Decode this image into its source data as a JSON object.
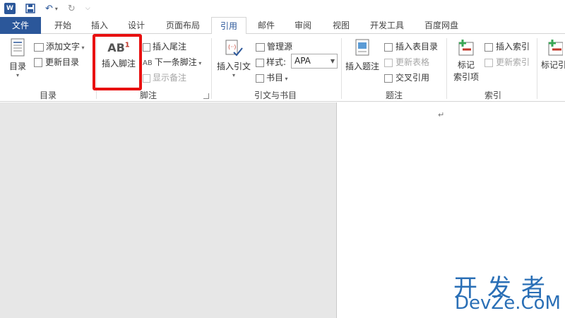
{
  "qat": {
    "app_logo": "W",
    "undo_label": "↶",
    "redo_label": "↻",
    "customize": "⌵"
  },
  "tabs": {
    "file": "文件",
    "items": [
      "开始",
      "插入",
      "设计",
      "页面布局",
      "引用",
      "邮件",
      "审阅",
      "视图",
      "开发工具",
      "百度网盘"
    ],
    "active": "引用"
  },
  "ribbon": {
    "toc": {
      "big": "目录",
      "add_text": "添加文字",
      "update": "更新目录",
      "group": "目录"
    },
    "footnotes": {
      "insert_footnote": "插入脚注",
      "insert_endnote": "插入尾注",
      "next_footnote": "下一条脚注",
      "show_notes": "显示备注",
      "group": "脚注",
      "icon_text": "AB",
      "icon_sup": "1"
    },
    "citations": {
      "insert_citation": "插入引文",
      "manage_sources": "管理源",
      "style_label": "样式:",
      "style_value": "APA",
      "bibliography": "书目",
      "group": "引文与书目"
    },
    "captions": {
      "insert_caption": "插入题注",
      "insert_table_of_figures": "插入表目录",
      "update_table": "更新表格",
      "cross_reference": "交叉引用",
      "group": "题注"
    },
    "index": {
      "mark_entry": "标记",
      "mark_entry2": "索引项",
      "insert_index": "插入索引",
      "update_index": "更新索引",
      "group": "索引"
    },
    "toa": {
      "mark_citation": "标记引"
    }
  },
  "document": {
    "paragraph_mark": "↵"
  },
  "watermark": {
    "line1": "开发者",
    "line2": "DevZe.CoM"
  },
  "colors": {
    "brand": "#2b579a",
    "highlight": "#e81010",
    "watermark": "#2a6fb6"
  }
}
